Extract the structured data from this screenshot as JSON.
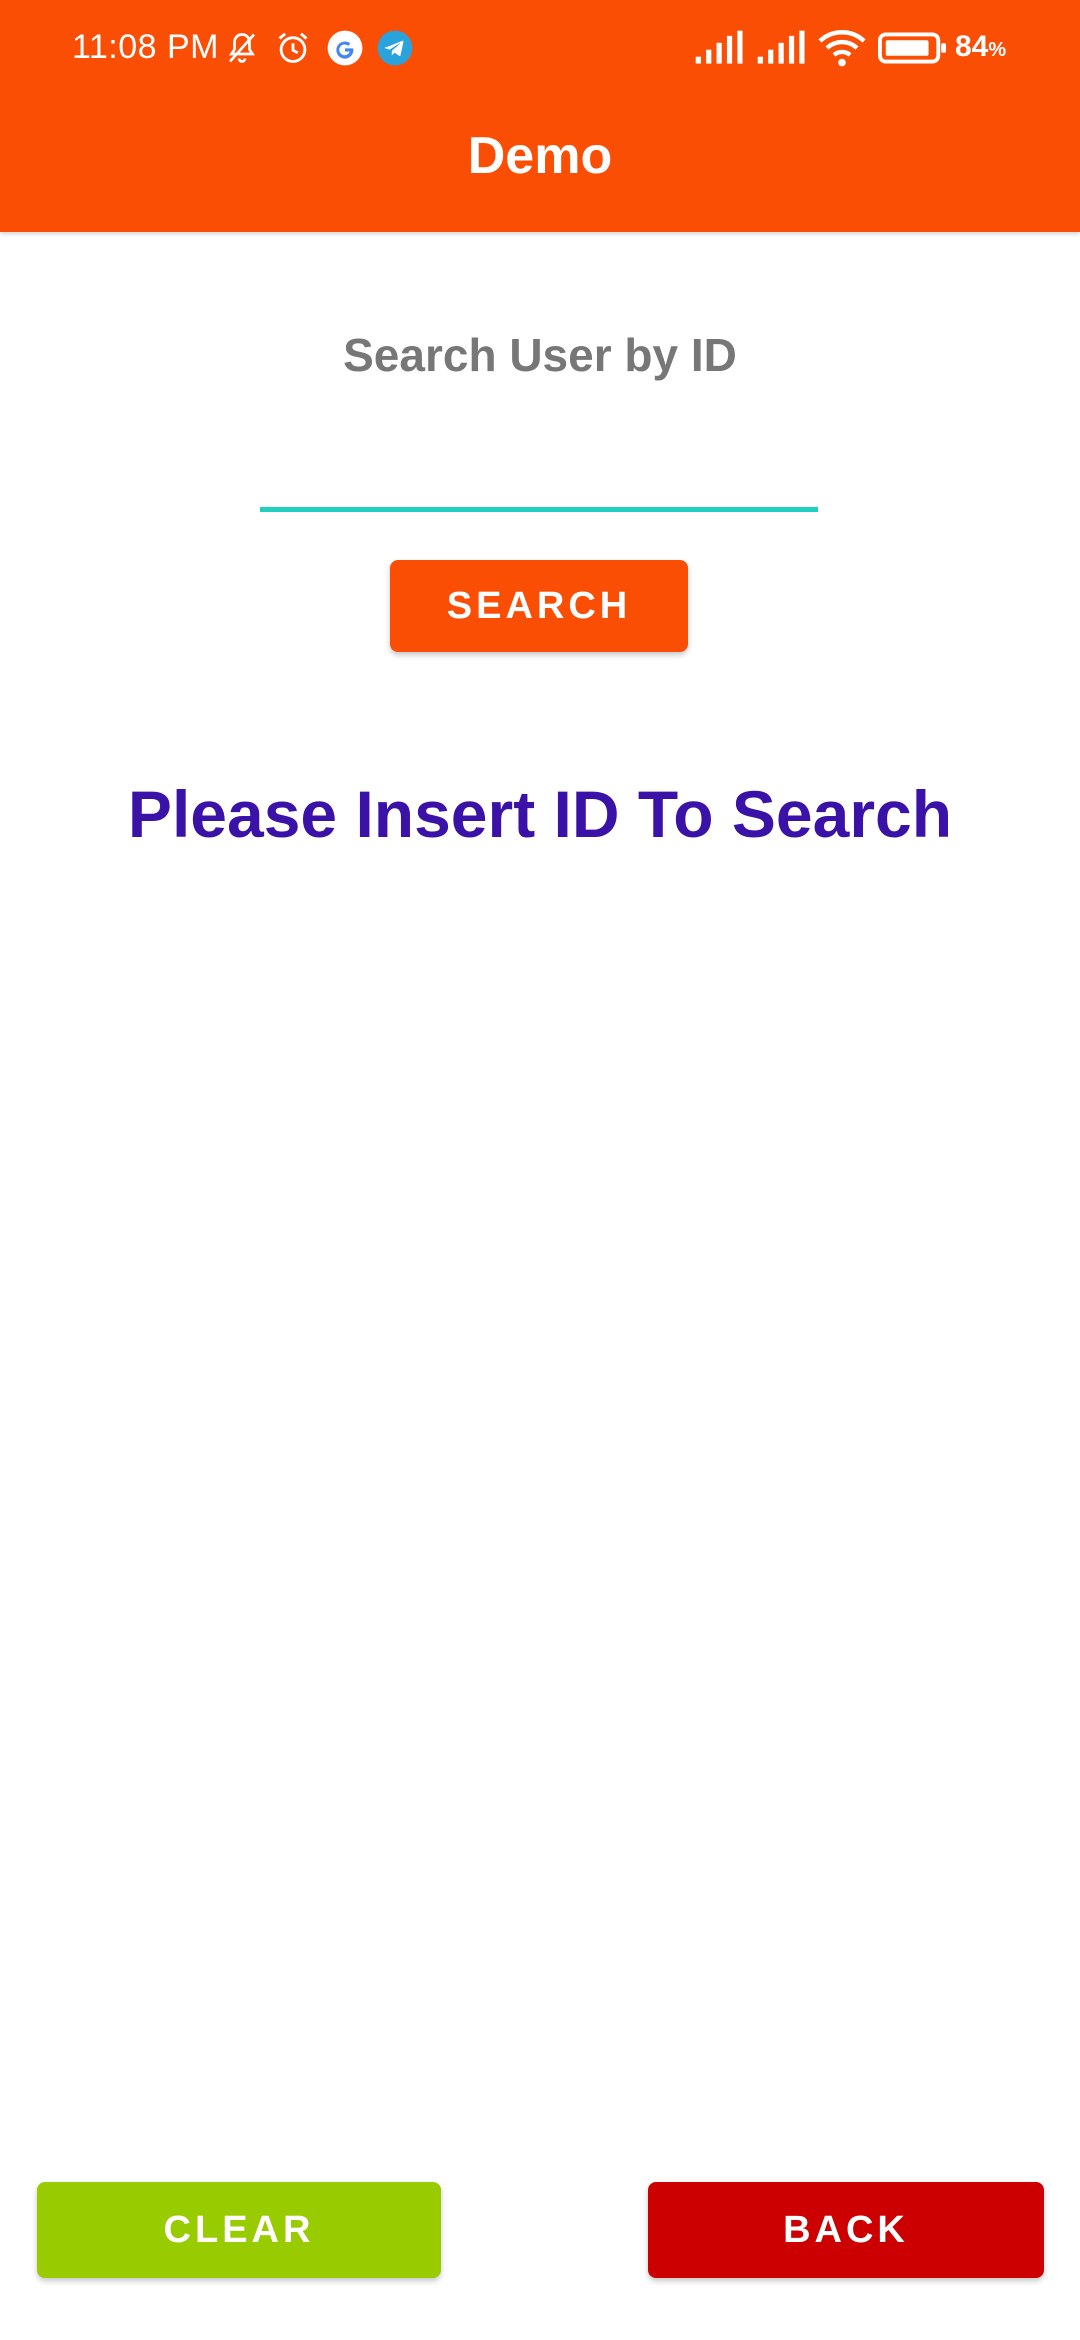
{
  "status_bar": {
    "time": "11:08 PM",
    "battery_percent": "84",
    "battery_unit": "%",
    "icons": [
      "bell-off-icon",
      "alarm-icon",
      "google-icon",
      "telegram-icon",
      "signal-icon",
      "signal-icon",
      "wifi-icon",
      "battery-icon"
    ]
  },
  "app_bar": {
    "title": "Demo",
    "color": "#fb4e05"
  },
  "search": {
    "heading": "Search User by ID",
    "input_value": "",
    "underline_color": "#1fcfbf",
    "button_label": "SEARCH"
  },
  "message": {
    "text": "Please Insert ID To Search",
    "color": "#3a12a8"
  },
  "bottom_buttons": {
    "clear_label": "CLEAR",
    "clear_color": "#98cc00",
    "back_label": "BACK",
    "back_color": "#cc0000"
  }
}
